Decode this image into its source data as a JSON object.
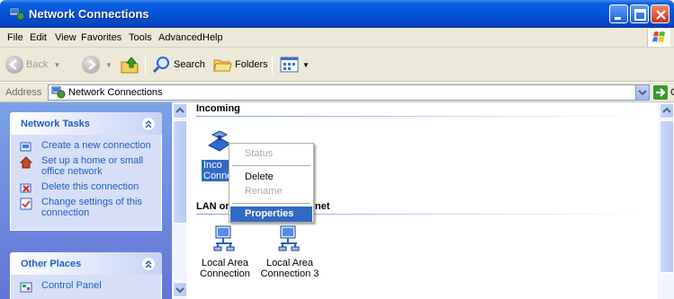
{
  "window": {
    "title": "Network Connections"
  },
  "menu": [
    "File",
    "Edit",
    "View",
    "Favorites",
    "Tools",
    "Advanced",
    "Help"
  ],
  "toolbar": {
    "back": "Back",
    "search": "Search",
    "folders": "Folders"
  },
  "address": {
    "label": "Address",
    "value": "Network Connections",
    "go": "Go"
  },
  "taskpane": {
    "network_tasks": {
      "title": "Network Tasks",
      "items": [
        "Create a new connection",
        "Set up a home or small office network",
        "Delete this connection",
        "Change settings of this connection"
      ]
    },
    "other_places": {
      "title": "Other Places",
      "items": [
        "Control Panel"
      ]
    }
  },
  "content": {
    "incoming_group": "Incoming",
    "incoming_item_partial": "Inco",
    "incoming_item_partial2": "Conne",
    "lan_group_left": "LAN or",
    "lan_group_right": "net",
    "lan_items": [
      {
        "line1": "Local Area",
        "line2": "Connection"
      },
      {
        "line1": "Local Area",
        "line2": "Connection 3"
      }
    ]
  },
  "context_menu": {
    "items": [
      {
        "label": "Status",
        "state": "disabled"
      },
      {
        "label": "Delete",
        "state": "enabled"
      },
      {
        "label": "Rename",
        "state": "disabled"
      },
      {
        "label": "Properties",
        "state": "highlighted"
      }
    ]
  },
  "colors": {
    "titlebar": "#0455d8",
    "highlight": "#316ac5",
    "link": "#215dc6"
  },
  "icons": [
    "network-connections-icon",
    "windows-flag-icon",
    "back-icon",
    "forward-icon",
    "up-folder-icon",
    "search-icon",
    "folders-icon",
    "views-icon",
    "go-icon",
    "incoming-connection-icon",
    "lan-connection-icon"
  ]
}
